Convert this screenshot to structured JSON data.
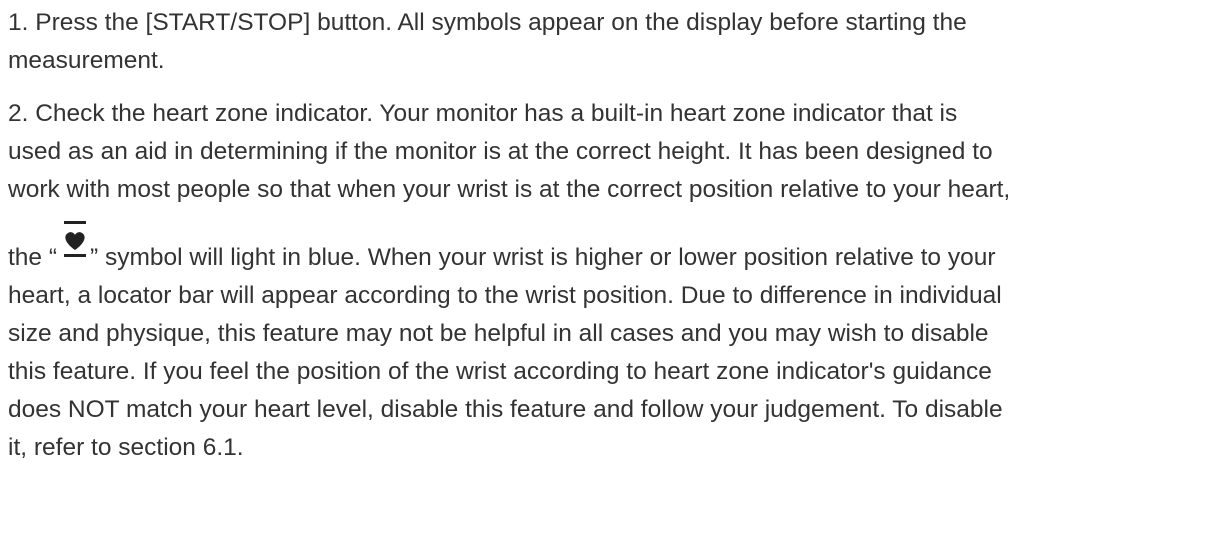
{
  "paragraph1": {
    "line1": "1. Press the [START/STOP] button. All symbols appear on the display before starting the",
    "line2": "measurement."
  },
  "paragraph2": {
    "line1": "2. Check the heart zone indicator. Your monitor has a built-in heart zone indicator that is",
    "line2": "used as an aid in determining if the monitor is at the correct height. It has been designed to",
    "line3": "work with most people so that when your wrist is at the correct position relative to your heart,",
    "line4_before": "the “",
    "line4_after": "” symbol will light in blue. When your wrist is higher or lower position relative to your",
    "line5": "heart, a locator bar will appear according to the wrist position. Due to difference in individual",
    "line6": "size and physique, this feature may not be helpful in all cases and you may wish to disable",
    "line7": "this feature. If you feel the position of the wrist according to heart zone indicator's guidance",
    "line8": "does NOT match your heart level, disable this feature and follow your judgement. To disable",
    "line9": "it, refer to section 6.1.",
    "symbol_icon": "heart-zone-indicator-icon"
  },
  "colors": {
    "text": "#333333",
    "icon": "#222222",
    "background": "#ffffff"
  }
}
